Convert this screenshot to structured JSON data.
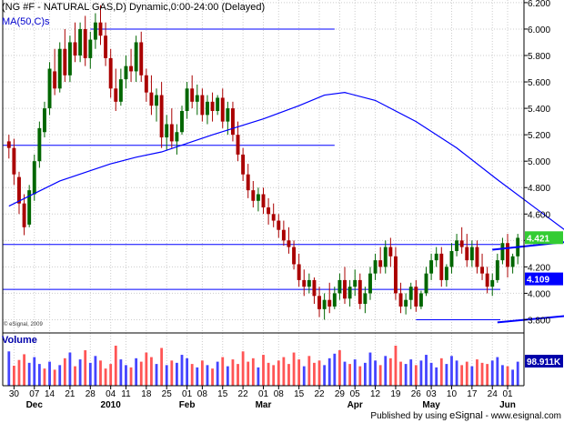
{
  "header": {
    "title": "(NG #F - NATURAL GAS,D) Dynamic,0:00-24:00 (Delayed)",
    "ma_label": "MA(50,C)s",
    "volume_label": "Volume",
    "copyright": "© eSignal, 2009",
    "published_prefix": "Published by using",
    "published_brand": "eSignal",
    "published_url": "- www.esignal.com"
  },
  "colors": {
    "up": "#006600",
    "down": "#aa0000",
    "ma": "#0000ff",
    "trendline": "#0000ff",
    "vol_up": "#4444ff",
    "vol_down": "#ff5555",
    "grid": "#cccccc",
    "tag_last": "#33cc33",
    "tag_ma": "#0000ff",
    "tag_vol": "#0000aa"
  },
  "chart_data": {
    "type": "candlestick",
    "title": "(NG #F - NATURAL GAS,D) Dynamic,0:00-24:00 (Delayed)",
    "y_ticks": [
      "6.200",
      "6.000",
      "5.800",
      "5.600",
      "5.400",
      "5.200",
      "5.000",
      "4.800",
      "4.600",
      "4.400",
      "4.200",
      "4.000",
      "3.800"
    ],
    "ylim": [
      3.7,
      6.22
    ],
    "x_ticks": [
      "30",
      "07",
      "14",
      "21",
      "28",
      "04",
      "11",
      "18",
      "25",
      "01",
      "08",
      "15",
      "22",
      "01",
      "08",
      "15",
      "22",
      "29",
      "05",
      "12",
      "19",
      "26",
      "03",
      "10",
      "17",
      "24",
      "01"
    ],
    "month_labels": [
      "Dec",
      "2010",
      "Feb",
      "Mar",
      "Apr",
      "May",
      "Jun"
    ],
    "last_price": "4.421",
    "ma_value": "4.109",
    "volume_value": "98.911K",
    "horizontal_levels": [
      6.0,
      5.12,
      4.37,
      4.03,
      3.8
    ],
    "trend_channel": {
      "upper": [
        {
          "day": 95,
          "price": 4.33
        },
        {
          "day": 157,
          "price": 4.58
        }
      ],
      "lower": [
        {
          "day": 96,
          "price": 3.78
        },
        {
          "day": 160,
          "price": 4.01
        }
      ]
    },
    "ma50": [
      [
        0,
        4.66
      ],
      [
        10,
        4.85
      ],
      [
        20,
        4.98
      ],
      [
        25,
        5.03
      ],
      [
        30,
        5.07
      ],
      [
        40,
        5.2
      ],
      [
        50,
        5.32
      ],
      [
        57,
        5.42
      ],
      [
        62,
        5.5
      ],
      [
        66,
        5.52
      ],
      [
        72,
        5.46
      ],
      [
        80,
        5.3
      ],
      [
        88,
        5.1
      ],
      [
        96,
        4.86
      ],
      [
        104,
        4.63
      ],
      [
        112,
        4.4
      ],
      [
        120,
        4.25
      ],
      [
        128,
        4.16
      ],
      [
        136,
        4.12
      ],
      [
        142,
        4.1
      ],
      [
        148,
        4.09
      ]
    ],
    "candles": [
      {
        "o": 5.15,
        "h": 5.2,
        "l": 5.02,
        "c": 5.1
      },
      {
        "o": 5.1,
        "h": 5.17,
        "l": 4.82,
        "c": 4.9
      },
      {
        "o": 4.88,
        "h": 4.92,
        "l": 4.6,
        "c": 4.68
      },
      {
        "o": 4.68,
        "h": 4.75,
        "l": 4.44,
        "c": 4.5
      },
      {
        "o": 4.52,
        "h": 4.82,
        "l": 4.5,
        "c": 4.78
      },
      {
        "o": 4.75,
        "h": 5.05,
        "l": 4.7,
        "c": 5.0
      },
      {
        "o": 5.0,
        "h": 5.3,
        "l": 4.95,
        "c": 5.25
      },
      {
        "o": 5.22,
        "h": 5.45,
        "l": 5.18,
        "c": 5.4
      },
      {
        "o": 5.4,
        "h": 5.75,
        "l": 5.35,
        "c": 5.7
      },
      {
        "o": 5.68,
        "h": 5.85,
        "l": 5.5,
        "c": 5.55
      },
      {
        "o": 5.55,
        "h": 5.9,
        "l": 5.52,
        "c": 5.85
      },
      {
        "o": 5.85,
        "h": 6.0,
        "l": 5.6,
        "c": 5.65
      },
      {
        "o": 5.65,
        "h": 5.95,
        "l": 5.6,
        "c": 5.9
      },
      {
        "o": 5.9,
        "h": 6.05,
        "l": 5.75,
        "c": 5.8
      },
      {
        "o": 5.8,
        "h": 6.05,
        "l": 5.75,
        "c": 6.0
      },
      {
        "o": 6.0,
        "h": 6.1,
        "l": 5.72,
        "c": 5.78
      },
      {
        "o": 5.78,
        "h": 5.98,
        "l": 5.7,
        "c": 5.92
      },
      {
        "o": 5.92,
        "h": 6.12,
        "l": 5.85,
        "c": 6.05
      },
      {
        "o": 6.05,
        "h": 6.18,
        "l": 5.88,
        "c": 5.95
      },
      {
        "o": 5.95,
        "h": 6.05,
        "l": 5.72,
        "c": 5.78
      },
      {
        "o": 5.78,
        "h": 5.85,
        "l": 5.48,
        "c": 5.55
      },
      {
        "o": 5.55,
        "h": 5.7,
        "l": 5.38,
        "c": 5.45
      },
      {
        "o": 5.45,
        "h": 5.7,
        "l": 5.42,
        "c": 5.62
      },
      {
        "o": 5.62,
        "h": 5.8,
        "l": 5.55,
        "c": 5.72
      },
      {
        "o": 5.72,
        "h": 5.85,
        "l": 5.6,
        "c": 5.68
      },
      {
        "o": 5.68,
        "h": 5.95,
        "l": 5.6,
        "c": 5.9
      },
      {
        "o": 5.9,
        "h": 5.98,
        "l": 5.6,
        "c": 5.65
      },
      {
        "o": 5.65,
        "h": 5.7,
        "l": 5.45,
        "c": 5.52
      },
      {
        "o": 5.52,
        "h": 5.65,
        "l": 5.35,
        "c": 5.42
      },
      {
        "o": 5.42,
        "h": 5.55,
        "l": 5.3,
        "c": 5.5
      },
      {
        "o": 5.5,
        "h": 5.6,
        "l": 5.1,
        "c": 5.18
      },
      {
        "o": 5.18,
        "h": 5.35,
        "l": 5.08,
        "c": 5.28
      },
      {
        "o": 5.28,
        "h": 5.4,
        "l": 5.1,
        "c": 5.15
      },
      {
        "o": 5.15,
        "h": 5.28,
        "l": 5.05,
        "c": 5.22
      },
      {
        "o": 5.22,
        "h": 5.42,
        "l": 5.2,
        "c": 5.38
      },
      {
        "o": 5.38,
        "h": 5.6,
        "l": 5.32,
        "c": 5.55
      },
      {
        "o": 5.55,
        "h": 5.65,
        "l": 5.4,
        "c": 5.45
      },
      {
        "o": 5.45,
        "h": 5.58,
        "l": 5.35,
        "c": 5.5
      },
      {
        "o": 5.5,
        "h": 5.55,
        "l": 5.3,
        "c": 5.35
      },
      {
        "o": 5.35,
        "h": 5.5,
        "l": 5.28,
        "c": 5.45
      },
      {
        "o": 5.45,
        "h": 5.52,
        "l": 5.3,
        "c": 5.38
      },
      {
        "o": 5.38,
        "h": 5.5,
        "l": 5.35,
        "c": 5.48
      },
      {
        "o": 5.48,
        "h": 5.55,
        "l": 5.25,
        "c": 5.3
      },
      {
        "o": 5.3,
        "h": 5.45,
        "l": 5.2,
        "c": 5.4
      },
      {
        "o": 5.4,
        "h": 5.45,
        "l": 5.15,
        "c": 5.2
      },
      {
        "o": 5.2,
        "h": 5.3,
        "l": 5.0,
        "c": 5.05
      },
      {
        "o": 5.05,
        "h": 5.1,
        "l": 4.85,
        "c": 4.9
      },
      {
        "o": 4.9,
        "h": 4.98,
        "l": 4.72,
        "c": 4.78
      },
      {
        "o": 4.78,
        "h": 4.85,
        "l": 4.65,
        "c": 4.7
      },
      {
        "o": 4.7,
        "h": 4.8,
        "l": 4.62,
        "c": 4.75
      },
      {
        "o": 4.75,
        "h": 4.8,
        "l": 4.6,
        "c": 4.65
      },
      {
        "o": 4.65,
        "h": 4.72,
        "l": 4.52,
        "c": 4.6
      },
      {
        "o": 4.6,
        "h": 4.68,
        "l": 4.5,
        "c": 4.55
      },
      {
        "o": 4.55,
        "h": 4.6,
        "l": 4.42,
        "c": 4.48
      },
      {
        "o": 4.48,
        "h": 4.55,
        "l": 4.36,
        "c": 4.4
      },
      {
        "o": 4.4,
        "h": 4.5,
        "l": 4.3,
        "c": 4.35
      },
      {
        "o": 4.35,
        "h": 4.4,
        "l": 4.18,
        "c": 4.22
      },
      {
        "o": 4.22,
        "h": 4.3,
        "l": 4.05,
        "c": 4.1
      },
      {
        "o": 4.1,
        "h": 4.18,
        "l": 3.98,
        "c": 4.05
      },
      {
        "o": 4.05,
        "h": 4.15,
        "l": 4.0,
        "c": 4.1
      },
      {
        "o": 4.1,
        "h": 4.12,
        "l": 3.92,
        "c": 3.98
      },
      {
        "o": 3.98,
        "h": 4.05,
        "l": 3.82,
        "c": 3.88
      },
      {
        "o": 3.88,
        "h": 4.0,
        "l": 3.8,
        "c": 3.95
      },
      {
        "o": 3.95,
        "h": 4.08,
        "l": 3.85,
        "c": 3.9
      },
      {
        "o": 3.9,
        "h": 4.05,
        "l": 3.88,
        "c": 4.0
      },
      {
        "o": 4.0,
        "h": 4.15,
        "l": 3.95,
        "c": 4.1
      },
      {
        "o": 4.1,
        "h": 4.2,
        "l": 3.92,
        "c": 3.96
      },
      {
        "o": 3.96,
        "h": 4.1,
        "l": 3.9,
        "c": 4.05
      },
      {
        "o": 4.05,
        "h": 4.18,
        "l": 3.98,
        "c": 4.1
      },
      {
        "o": 4.1,
        "h": 4.15,
        "l": 3.88,
        "c": 3.92
      },
      {
        "o": 3.92,
        "h": 4.05,
        "l": 3.85,
        "c": 4.0
      },
      {
        "o": 4.0,
        "h": 4.2,
        "l": 3.95,
        "c": 4.15
      },
      {
        "o": 4.15,
        "h": 4.3,
        "l": 4.1,
        "c": 4.25
      },
      {
        "o": 4.25,
        "h": 4.35,
        "l": 4.15,
        "c": 4.2
      },
      {
        "o": 4.2,
        "h": 4.4,
        "l": 4.15,
        "c": 4.35
      },
      {
        "o": 4.35,
        "h": 4.42,
        "l": 4.2,
        "c": 4.28
      },
      {
        "o": 4.28,
        "h": 4.35,
        "l": 3.95,
        "c": 4.0
      },
      {
        "o": 4.0,
        "h": 4.08,
        "l": 3.85,
        "c": 3.9
      },
      {
        "o": 3.9,
        "h": 4.0,
        "l": 3.84,
        "c": 3.95
      },
      {
        "o": 3.95,
        "h": 4.08,
        "l": 3.88,
        "c": 4.05
      },
      {
        "o": 4.05,
        "h": 4.1,
        "l": 3.86,
        "c": 3.9
      },
      {
        "o": 3.9,
        "h": 4.02,
        "l": 3.88,
        "c": 4.0
      },
      {
        "o": 4.0,
        "h": 4.2,
        "l": 3.98,
        "c": 4.15
      },
      {
        "o": 4.15,
        "h": 4.3,
        "l": 4.1,
        "c": 4.25
      },
      {
        "o": 4.25,
        "h": 4.35,
        "l": 4.2,
        "c": 4.3
      },
      {
        "o": 4.3,
        "h": 4.35,
        "l": 4.05,
        "c": 4.1
      },
      {
        "o": 4.1,
        "h": 4.22,
        "l": 4.05,
        "c": 4.2
      },
      {
        "o": 4.2,
        "h": 4.38,
        "l": 4.15,
        "c": 4.32
      },
      {
        "o": 4.32,
        "h": 4.45,
        "l": 4.28,
        "c": 4.4
      },
      {
        "o": 4.4,
        "h": 4.5,
        "l": 4.3,
        "c": 4.35
      },
      {
        "o": 4.35,
        "h": 4.45,
        "l": 4.2,
        "c": 4.25
      },
      {
        "o": 4.25,
        "h": 4.4,
        "l": 4.2,
        "c": 4.35
      },
      {
        "o": 4.35,
        "h": 4.4,
        "l": 4.15,
        "c": 4.2
      },
      {
        "o": 4.2,
        "h": 4.3,
        "l": 4.1,
        "c": 4.15
      },
      {
        "o": 4.15,
        "h": 4.2,
        "l": 4.0,
        "c": 4.05
      },
      {
        "o": 4.05,
        "h": 4.15,
        "l": 3.98,
        "c": 4.1
      },
      {
        "o": 4.1,
        "h": 4.3,
        "l": 4.08,
        "c": 4.25
      },
      {
        "o": 4.25,
        "h": 4.42,
        "l": 4.22,
        "c": 4.38
      },
      {
        "o": 4.38,
        "h": 4.45,
        "l": 4.12,
        "c": 4.2
      },
      {
        "o": 4.2,
        "h": 4.3,
        "l": 4.15,
        "c": 4.28
      },
      {
        "o": 4.28,
        "h": 4.45,
        "l": 4.22,
        "c": 4.42
      }
    ],
    "volume": [
      {
        "v": 60,
        "up": true
      },
      {
        "v": 35,
        "up": false
      },
      {
        "v": 45,
        "up": false
      },
      {
        "v": 55,
        "up": false
      },
      {
        "v": 40,
        "up": true
      },
      {
        "v": 50,
        "up": true
      },
      {
        "v": 38,
        "up": true
      },
      {
        "v": 30,
        "up": false
      },
      {
        "v": 42,
        "up": true
      },
      {
        "v": 28,
        "up": false
      },
      {
        "v": 36,
        "up": true
      },
      {
        "v": 48,
        "up": false
      },
      {
        "v": 58,
        "up": true
      },
      {
        "v": 34,
        "up": false
      },
      {
        "v": 46,
        "up": true
      },
      {
        "v": 62,
        "up": false
      },
      {
        "v": 40,
        "up": true
      },
      {
        "v": 52,
        "up": true
      },
      {
        "v": 44,
        "up": false
      },
      {
        "v": 30,
        "up": false
      },
      {
        "v": 38,
        "up": false
      },
      {
        "v": 70,
        "up": false
      },
      {
        "v": 46,
        "up": true
      },
      {
        "v": 36,
        "up": true
      },
      {
        "v": 32,
        "up": false
      },
      {
        "v": 48,
        "up": true
      },
      {
        "v": 42,
        "up": false
      },
      {
        "v": 58,
        "up": false
      },
      {
        "v": 50,
        "up": false
      },
      {
        "v": 38,
        "up": true
      },
      {
        "v": 66,
        "up": false
      },
      {
        "v": 36,
        "up": true
      },
      {
        "v": 44,
        "up": false
      },
      {
        "v": 40,
        "up": true
      },
      {
        "v": 54,
        "up": true
      },
      {
        "v": 48,
        "up": true
      },
      {
        "v": 38,
        "up": false
      },
      {
        "v": 32,
        "up": true
      },
      {
        "v": 44,
        "up": false
      },
      {
        "v": 36,
        "up": true
      },
      {
        "v": 30,
        "up": false
      },
      {
        "v": 42,
        "up": true
      },
      {
        "v": 50,
        "up": false
      },
      {
        "v": 34,
        "up": true
      },
      {
        "v": 46,
        "up": false
      },
      {
        "v": 38,
        "up": false
      },
      {
        "v": 60,
        "up": false
      },
      {
        "v": 42,
        "up": false
      },
      {
        "v": 48,
        "up": false
      },
      {
        "v": 32,
        "up": true
      },
      {
        "v": 54,
        "up": false
      },
      {
        "v": 40,
        "up": false
      },
      {
        "v": 36,
        "up": false
      },
      {
        "v": 44,
        "up": false
      },
      {
        "v": 50,
        "up": false
      },
      {
        "v": 38,
        "up": false
      },
      {
        "v": 58,
        "up": false
      },
      {
        "v": 46,
        "up": false
      },
      {
        "v": 34,
        "up": true
      },
      {
        "v": 52,
        "up": false
      },
      {
        "v": 40,
        "up": false
      },
      {
        "v": 44,
        "up": false
      },
      {
        "v": 36,
        "up": true
      },
      {
        "v": 48,
        "up": true
      },
      {
        "v": 56,
        "up": true
      },
      {
        "v": 62,
        "up": false
      },
      {
        "v": 42,
        "up": true
      },
      {
        "v": 38,
        "up": false
      },
      {
        "v": 46,
        "up": true
      },
      {
        "v": 34,
        "up": false
      },
      {
        "v": 40,
        "up": true
      },
      {
        "v": 58,
        "up": true
      },
      {
        "v": 44,
        "up": true
      },
      {
        "v": 36,
        "up": false
      },
      {
        "v": 52,
        "up": true
      },
      {
        "v": 48,
        "up": false
      },
      {
        "v": 70,
        "up": false
      },
      {
        "v": 42,
        "up": false
      },
      {
        "v": 38,
        "up": true
      },
      {
        "v": 46,
        "up": true
      },
      {
        "v": 36,
        "up": false
      },
      {
        "v": 44,
        "up": true
      },
      {
        "v": 54,
        "up": true
      },
      {
        "v": 40,
        "up": true
      },
      {
        "v": 32,
        "up": true
      },
      {
        "v": 48,
        "up": false
      },
      {
        "v": 38,
        "up": true
      },
      {
        "v": 52,
        "up": true
      },
      {
        "v": 44,
        "up": true
      },
      {
        "v": 36,
        "up": false
      },
      {
        "v": 42,
        "up": false
      },
      {
        "v": 34,
        "up": true
      },
      {
        "v": 46,
        "up": false
      },
      {
        "v": 40,
        "up": false
      },
      {
        "v": 38,
        "up": false
      },
      {
        "v": 44,
        "up": true
      },
      {
        "v": 50,
        "up": true
      },
      {
        "v": 36,
        "up": true
      },
      {
        "v": 34,
        "up": false
      },
      {
        "v": 28,
        "up": true
      },
      {
        "v": 42,
        "up": true
      }
    ]
  }
}
